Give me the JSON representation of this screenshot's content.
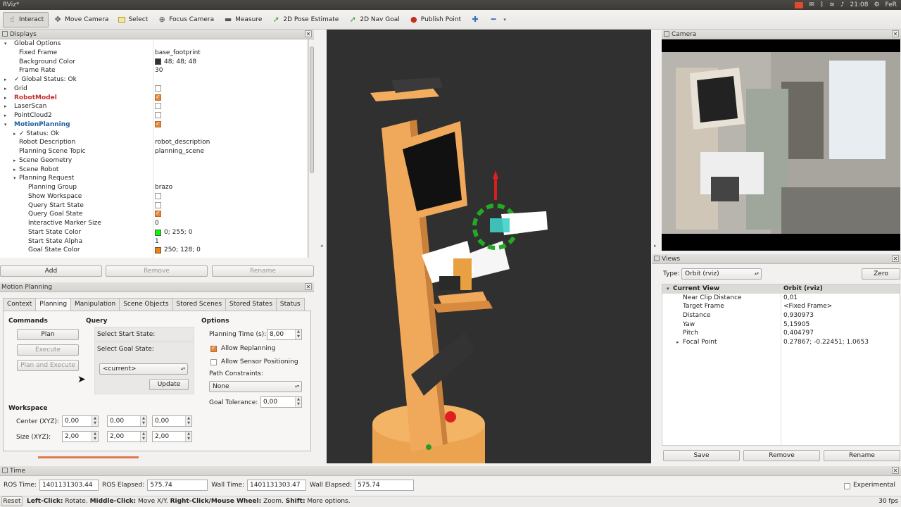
{
  "window": {
    "title": "RViz*",
    "user": "FeR",
    "clock": "21:08"
  },
  "toolbar": {
    "tools": [
      {
        "label": "Interact",
        "icon": "hand-icon"
      },
      {
        "label": "Move Camera",
        "icon": "move-camera-icon"
      },
      {
        "label": "Select",
        "icon": "select-icon"
      },
      {
        "label": "Focus Camera",
        "icon": "focus-camera-icon"
      },
      {
        "label": "Measure",
        "icon": "ruler-icon"
      },
      {
        "label": "2D Pose Estimate",
        "icon": "pose-arrow-icon"
      },
      {
        "label": "2D Nav Goal",
        "icon": "nav-arrow-icon"
      },
      {
        "label": "Publish Point",
        "icon": "pin-icon"
      }
    ]
  },
  "displays": {
    "title": "Displays",
    "rows": [
      {
        "label": "Global Options",
        "value": "",
        "indent": 0,
        "arrow": "▾",
        "kind": "plain"
      },
      {
        "label": "Fixed Frame",
        "value": "base_footprint",
        "indent": 1,
        "arrow": "",
        "kind": "plain"
      },
      {
        "label": "Background Color",
        "value": "48; 48; 48",
        "indent": 1,
        "arrow": "",
        "kind": "color",
        "color": "#303030"
      },
      {
        "label": "Frame Rate",
        "value": "30",
        "indent": 1,
        "arrow": "",
        "kind": "plain"
      },
      {
        "label": "Global Status: Ok",
        "value": "",
        "indent": 0,
        "arrow": "▸",
        "kind": "status"
      },
      {
        "label": "Grid",
        "value": "",
        "indent": 0,
        "arrow": "▸",
        "kind": "check",
        "checked": false
      },
      {
        "label": "RobotModel",
        "value": "",
        "indent": 0,
        "arrow": "▸",
        "kind": "check",
        "checked": true,
        "style": "red"
      },
      {
        "label": "LaserScan",
        "value": "",
        "indent": 0,
        "arrow": "▸",
        "kind": "check",
        "checked": false
      },
      {
        "label": "PointCloud2",
        "value": "",
        "indent": 0,
        "arrow": "▸",
        "kind": "check",
        "checked": false
      },
      {
        "label": "MotionPlanning",
        "value": "",
        "indent": 0,
        "arrow": "▾",
        "kind": "check",
        "checked": true,
        "style": "blue"
      },
      {
        "label": "Status: Ok",
        "value": "",
        "indent": 1,
        "arrow": "▸",
        "kind": "status"
      },
      {
        "label": "Robot Description",
        "value": "robot_description",
        "indent": 1,
        "arrow": "",
        "kind": "plain"
      },
      {
        "label": "Planning Scene Topic",
        "value": "planning_scene",
        "indent": 1,
        "arrow": "",
        "kind": "plain"
      },
      {
        "label": "Scene Geometry",
        "value": "",
        "indent": 1,
        "arrow": "▸",
        "kind": "plain"
      },
      {
        "label": "Scene Robot",
        "value": "",
        "indent": 1,
        "arrow": "▸",
        "kind": "plain"
      },
      {
        "label": "Planning Request",
        "value": "",
        "indent": 1,
        "arrow": "▾",
        "kind": "plain"
      },
      {
        "label": "Planning Group",
        "value": "brazo",
        "indent": 2,
        "arrow": "",
        "kind": "plain"
      },
      {
        "label": "Show Workspace",
        "value": "",
        "indent": 2,
        "arrow": "",
        "kind": "check",
        "checked": false
      },
      {
        "label": "Query Start State",
        "value": "",
        "indent": 2,
        "arrow": "",
        "kind": "check",
        "checked": false
      },
      {
        "label": "Query Goal State",
        "value": "",
        "indent": 2,
        "arrow": "",
        "kind": "check",
        "checked": true
      },
      {
        "label": "Interactive Marker Size",
        "value": "0",
        "indent": 2,
        "arrow": "",
        "kind": "plain"
      },
      {
        "label": "Start State Color",
        "value": "0; 255; 0",
        "indent": 2,
        "arrow": "",
        "kind": "color",
        "color": "#00ff00"
      },
      {
        "label": "Start State Alpha",
        "value": "1",
        "indent": 2,
        "arrow": "",
        "kind": "plain"
      },
      {
        "label": "Goal State Color",
        "value": "250; 128; 0",
        "indent": 2,
        "arrow": "",
        "kind": "color",
        "color": "#fa8000"
      }
    ],
    "buttons": {
      "add": "Add",
      "remove": "Remove",
      "rename": "Rename"
    }
  },
  "motion_planning": {
    "title": "Motion Planning",
    "tabs": [
      "Context",
      "Planning",
      "Manipulation",
      "Scene Objects",
      "Stored Scenes",
      "Stored States",
      "Status"
    ],
    "active_tab": "Planning",
    "commands": {
      "header": "Commands",
      "plan": "Plan",
      "execute": "Execute",
      "plan_execute": "Plan and Execute"
    },
    "query": {
      "header": "Query",
      "start": "Select Start State:",
      "goal": "Select Goal State:",
      "state": "<current>",
      "update": "Update"
    },
    "options": {
      "header": "Options",
      "planning_time_label": "Planning Time (s):",
      "planning_time": "8,00",
      "allow_replanning": "Allow Replanning",
      "allow_replanning_checked": true,
      "allow_sensor": "Allow Sensor Positioning",
      "allow_sensor_checked": false,
      "path_constraints_label": "Path Constraints:",
      "path_constraints": "None",
      "goal_tolerance_label": "Goal Tolerance:",
      "goal_tolerance": "0,00"
    },
    "workspace": {
      "header": "Workspace",
      "center_label": "Center (XYZ):",
      "center": [
        "0,00",
        "0,00",
        "0,00"
      ],
      "size_label": "Size (XYZ):",
      "size": [
        "2,00",
        "2,00",
        "2,00"
      ]
    }
  },
  "camera": {
    "title": "Camera"
  },
  "views": {
    "title": "Views",
    "type_label": "Type:",
    "type_value": "Orbit (rviz)",
    "zero": "Zero",
    "current": {
      "label": "Current View",
      "value": "Orbit (rviz)"
    },
    "rows": [
      {
        "label": "Near Clip Distance",
        "value": "0,01"
      },
      {
        "label": "Target Frame",
        "value": "<Fixed Frame>"
      },
      {
        "label": "Distance",
        "value": "0,930973"
      },
      {
        "label": "Yaw",
        "value": "5,15905"
      },
      {
        "label": "Pitch",
        "value": "0,404797"
      },
      {
        "label": "Focal Point",
        "value": "0.27867; -0.22451; 1.0653"
      }
    ],
    "buttons": {
      "save": "Save",
      "remove": "Remove",
      "rename": "Rename"
    }
  },
  "time": {
    "title": "Time",
    "ros_time_label": "ROS Time:",
    "ros_time": "1401131303.44",
    "ros_elapsed_label": "ROS Elapsed:",
    "ros_elapsed": "575.74",
    "wall_time_label": "Wall Time:",
    "wall_time": "1401131303.47",
    "wall_elapsed_label": "Wall Elapsed:",
    "wall_elapsed": "575.74",
    "experimental": "Experimental"
  },
  "status": {
    "reset": "Reset",
    "hint_left": "Left-Click:",
    "hint_left_text": " Rotate. ",
    "hint_mid": "Middle-Click:",
    "hint_mid_text": " Move X/Y. ",
    "hint_right": "Right-Click/Mouse Wheel:",
    "hint_right_text": " Zoom. ",
    "hint_shift": "Shift:",
    "hint_shift_text": " More options.",
    "fps": "30 fps"
  }
}
